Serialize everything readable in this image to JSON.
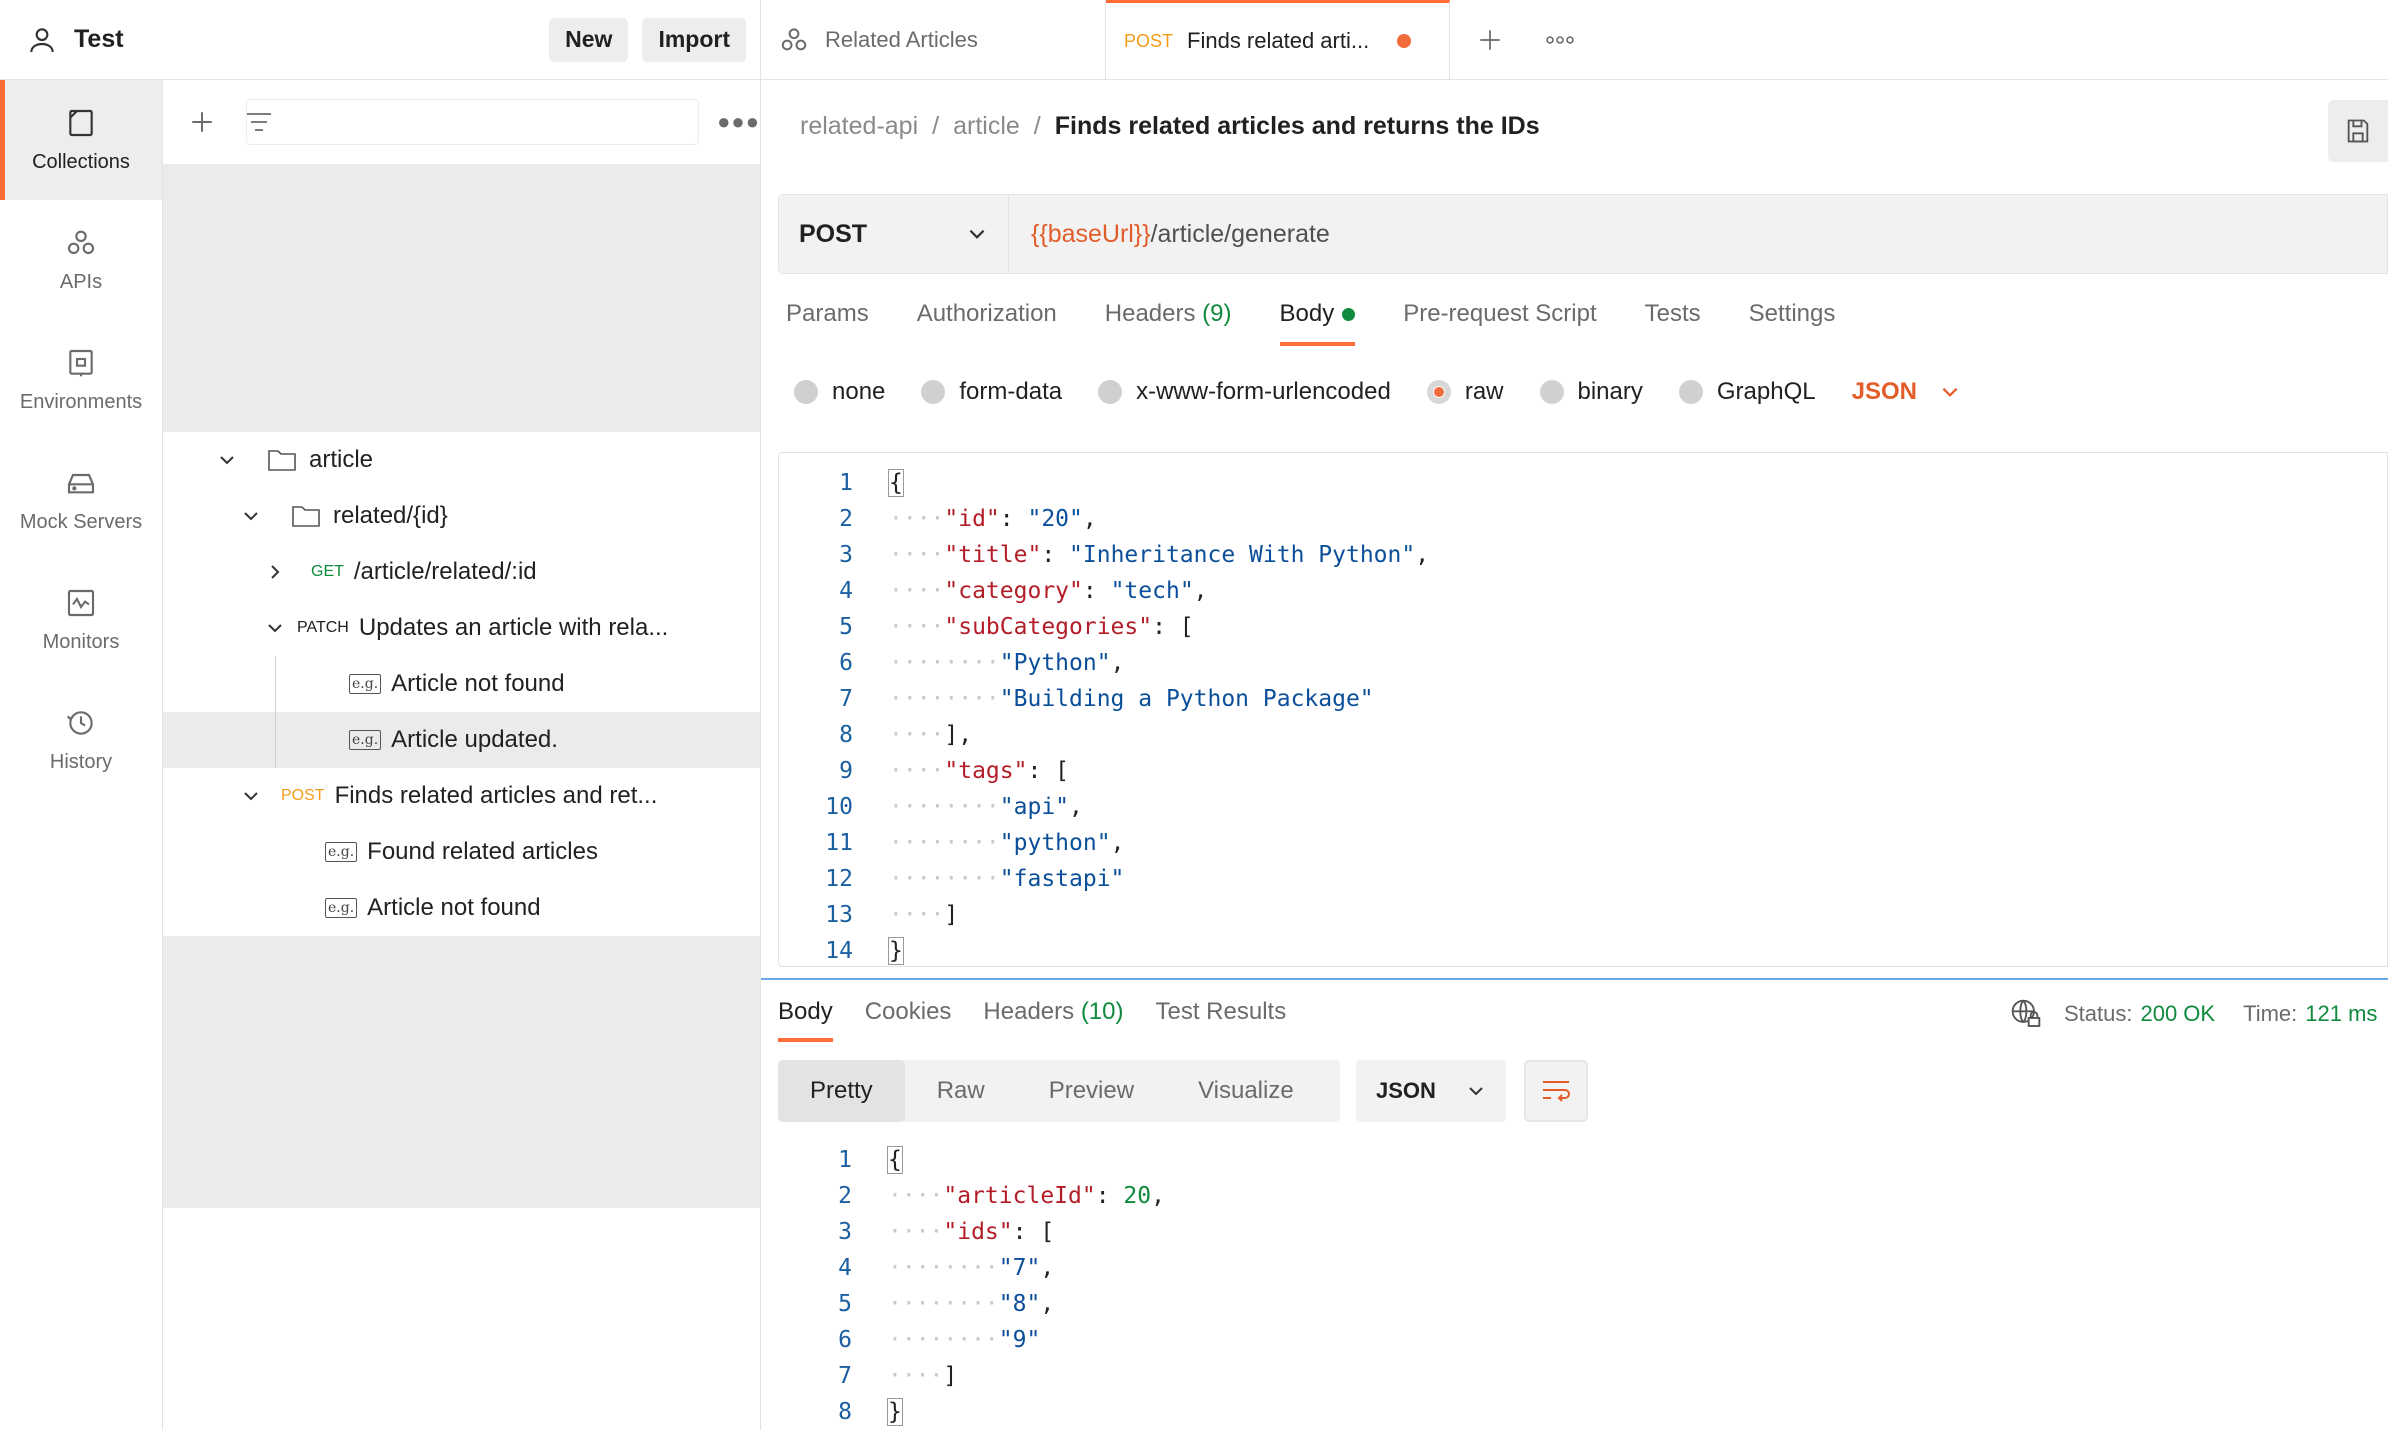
{
  "workspace": {
    "name": "Test",
    "new_label": "New",
    "import_label": "Import"
  },
  "rail": [
    {
      "label": "Collections",
      "icon": "collections-icon"
    },
    {
      "label": "APIs",
      "icon": "apis-icon"
    },
    {
      "label": "Environments",
      "icon": "environments-icon"
    },
    {
      "label": "Mock Servers",
      "icon": "mock-servers-icon"
    },
    {
      "label": "Monitors",
      "icon": "monitors-icon"
    },
    {
      "label": "History",
      "icon": "history-icon"
    }
  ],
  "tree": {
    "folder": "article",
    "subfolder": "related/{id}",
    "get_method": "GET",
    "get_label": "/article/related/:id",
    "patch_method": "PATCH",
    "patch_label": "Updates an article with rela...",
    "patch_examples": [
      "Article not found",
      "Article updated."
    ],
    "post_method": "POST",
    "post_label": "Finds related articles and ret...",
    "post_examples": [
      "Found related articles",
      "Article not found"
    ],
    "example_badge": "e.g."
  },
  "tabs": {
    "tab1": "Related Articles",
    "tab2_method": "POST",
    "tab2": "Finds related arti..."
  },
  "breadcrumb": {
    "c1": "related-api",
    "c2": "article",
    "c3": "Finds related articles and returns the IDs",
    "sep": "/"
  },
  "request": {
    "method": "POST",
    "url_var": "{{baseUrl}}",
    "url_path": "/article/generate"
  },
  "req_tabs": {
    "params": "Params",
    "auth": "Authorization",
    "headers": "Headers",
    "headers_count": "(9)",
    "body": "Body",
    "prerequest": "Pre-request Script",
    "tests": "Tests",
    "settings": "Settings"
  },
  "body_types": {
    "none": "none",
    "formdata": "form-data",
    "urlencoded": "x-www-form-urlencoded",
    "raw": "raw",
    "binary": "binary",
    "graphql": "GraphQL",
    "lang": "JSON"
  },
  "request_body_lines": [
    "1",
    "2",
    "3",
    "4",
    "5",
    "6",
    "7",
    "8",
    "9",
    "10",
    "11",
    "12",
    "13",
    "14"
  ],
  "request_body": {
    "id": "\"id\"",
    "id_val": "\"20\"",
    "title": "\"title\"",
    "title_val": "\"Inheritance With Python\"",
    "category": "\"category\"",
    "category_val": "\"tech\"",
    "subcats": "\"subCategories\"",
    "sub1": "\"Python\"",
    "sub2": "\"Building a Python Package\"",
    "tags": "\"tags\"",
    "tag1": "\"api\"",
    "tag2": "\"python\"",
    "tag3": "\"fastapi\""
  },
  "response": {
    "tab_body": "Body",
    "tab_cookies": "Cookies",
    "tab_headers": "Headers",
    "headers_count": "(10)",
    "tab_tests": "Test Results",
    "status_label": "Status:",
    "status_value": "200 OK",
    "time_label": "Time:",
    "time_value": "121 ms",
    "views": [
      "Pretty",
      "Raw",
      "Preview",
      "Visualize"
    ],
    "lang": "JSON",
    "body": {
      "articleId": "\"articleId\"",
      "articleId_val": "20",
      "ids": "\"ids\"",
      "id1": "\"7\"",
      "id2": "\"8\"",
      "id3": "\"9\""
    },
    "lines": [
      "1",
      "2",
      "3",
      "4",
      "5",
      "6",
      "7",
      "8"
    ]
  },
  "colors": {
    "accent": "#ff6c37",
    "success": "#0f8a3e",
    "json_key": "#b31d28",
    "json_string": "#0b4f9a"
  }
}
